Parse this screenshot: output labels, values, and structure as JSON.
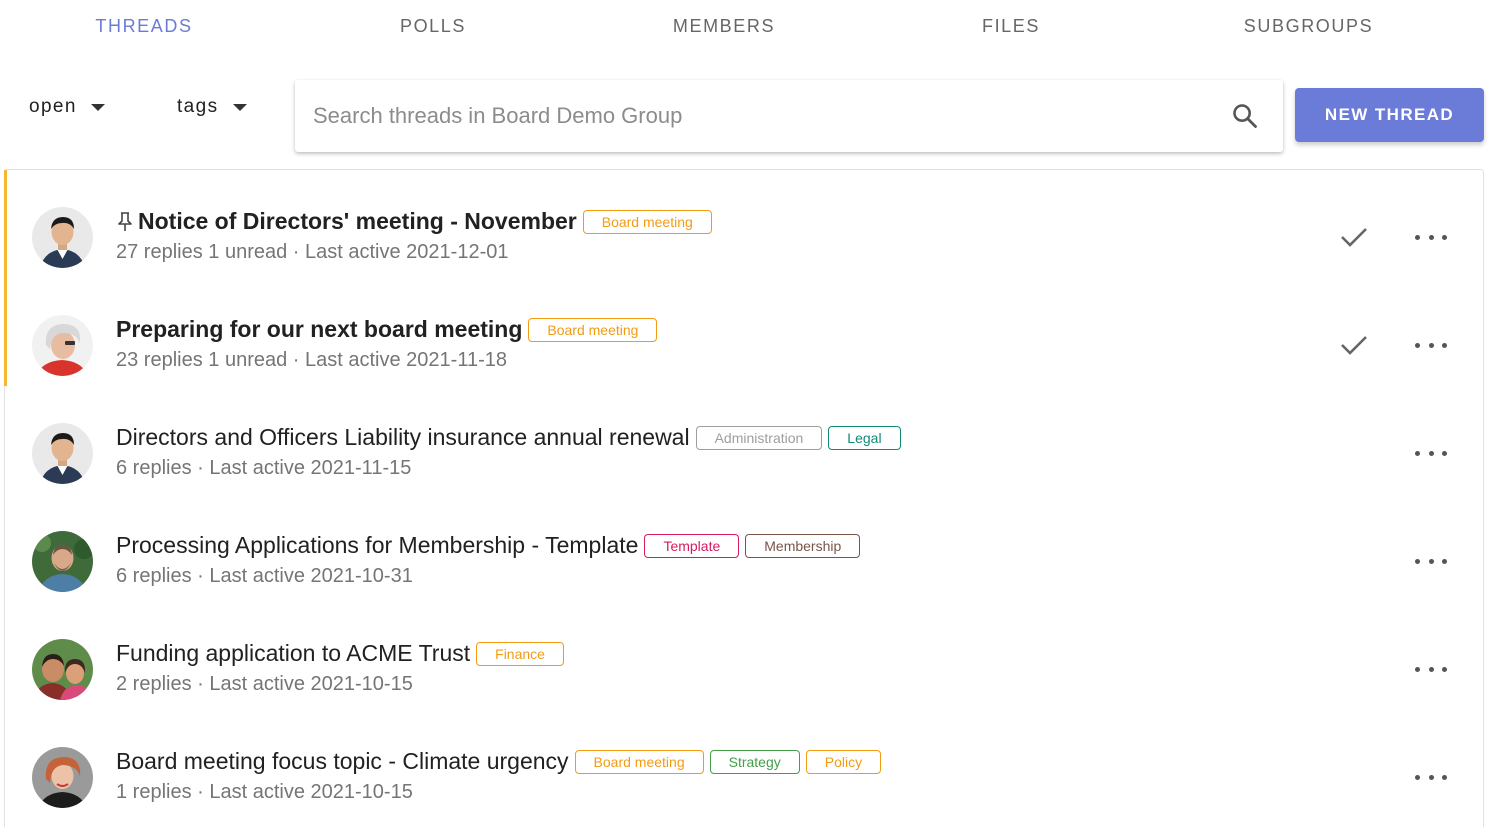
{
  "tabs": [
    {
      "label": "THREADS",
      "active": true
    },
    {
      "label": "POLLS",
      "active": false
    },
    {
      "label": "MEMBERS",
      "active": false
    },
    {
      "label": "FILES",
      "active": false
    },
    {
      "label": "SUBGROUPS",
      "active": false
    }
  ],
  "filters": {
    "status_label": "open",
    "tags_label": "tags"
  },
  "search": {
    "placeholder": "Search threads in Board Demo Group",
    "icon": "search-icon"
  },
  "new_thread_button": "NEW THREAD",
  "colors": {
    "accent": "#6b7bd8",
    "unread_bar": "#f5b731",
    "tag_orange": "#f39c12",
    "tag_grey": "#9e9e9e",
    "tag_teal": "#138a78",
    "tag_pink": "#d81b60",
    "tag_brown": "#795548",
    "tag_green": "#43a047"
  },
  "threads": [
    {
      "title": "Notice of Directors' meeting - November",
      "pinned": true,
      "unread": true,
      "tags": [
        {
          "label": "Board meeting",
          "color": "#f39c12"
        }
      ],
      "meta": "27 replies 1 unread · Last active 2021-12-01",
      "show_check": true,
      "avatar": "avatar-man-asian"
    },
    {
      "title": "Preparing for our next board meeting",
      "pinned": false,
      "unread": true,
      "tags": [
        {
          "label": "Board meeting",
          "color": "#f39c12"
        }
      ],
      "meta": "23 replies 1 unread · Last active 2021-11-18",
      "show_check": true,
      "avatar": "avatar-woman-grey-hair"
    },
    {
      "title": "Directors and Officers Liability insurance annual renewal",
      "pinned": false,
      "unread": false,
      "tags": [
        {
          "label": "Administration",
          "color": "#9e9e9e"
        },
        {
          "label": "Legal",
          "color": "#138a78"
        }
      ],
      "meta": "6 replies  · Last active 2021-11-15",
      "show_check": false,
      "avatar": "avatar-man-asian"
    },
    {
      "title": "Processing Applications for Membership - Template",
      "pinned": false,
      "unread": false,
      "tags": [
        {
          "label": "Template",
          "color": "#d81b60"
        },
        {
          "label": "Membership",
          "color": "#795548"
        }
      ],
      "meta": "6 replies  · Last active 2021-10-31",
      "show_check": false,
      "avatar": "avatar-man-bald"
    },
    {
      "title": "Funding application to ACME Trust",
      "pinned": false,
      "unread": false,
      "tags": [
        {
          "label": "Finance",
          "color": "#f39c12"
        }
      ],
      "meta": "2 replies  · Last active 2021-10-15",
      "show_check": false,
      "avatar": "avatar-father-child"
    },
    {
      "title": "Board meeting focus topic - Climate urgency",
      "pinned": false,
      "unread": false,
      "tags": [
        {
          "label": "Board meeting",
          "color": "#f39c12"
        },
        {
          "label": "Strategy",
          "color": "#43a047"
        },
        {
          "label": "Policy",
          "color": "#f39c12"
        }
      ],
      "meta": "1 replies  · Last active 2021-10-15",
      "show_check": false,
      "avatar": "avatar-woman-red-hair"
    }
  ]
}
